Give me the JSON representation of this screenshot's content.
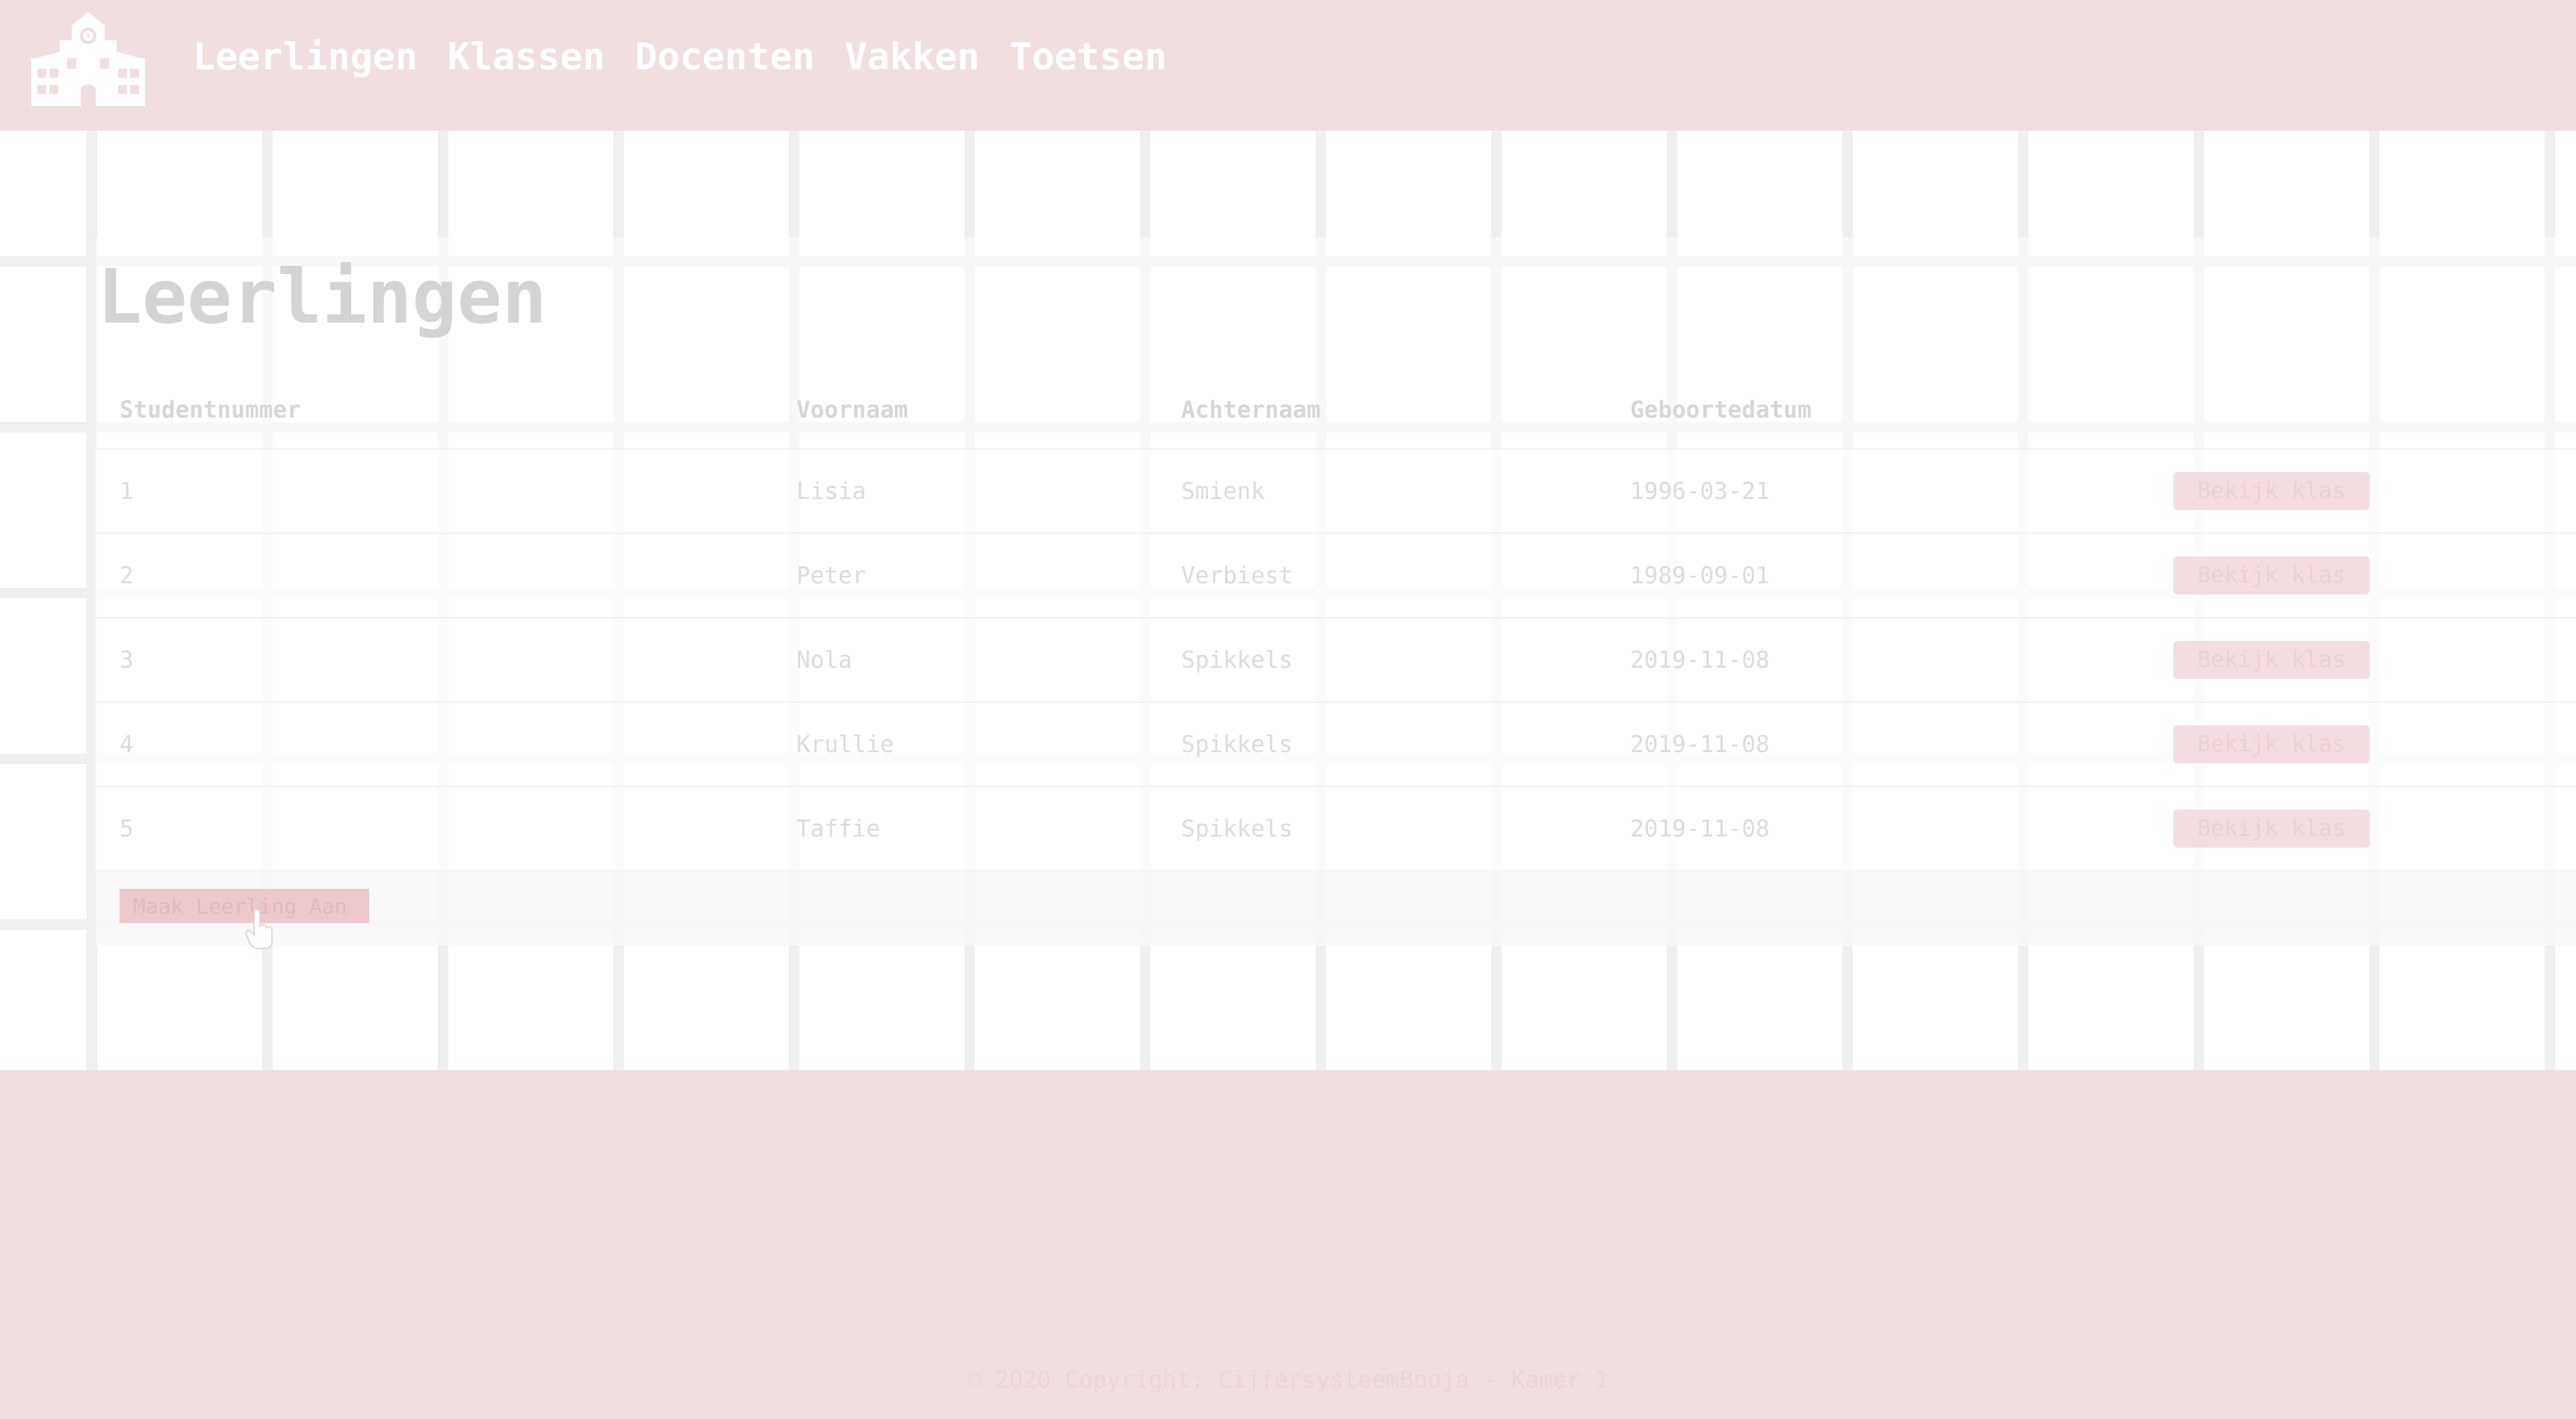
{
  "nav": {
    "logo_icon": "school-building-icon",
    "links": [
      "Leerlingen",
      "Klassen",
      "Docenten",
      "Vakken",
      "Toetsen"
    ]
  },
  "page": {
    "title": "Leerlingen"
  },
  "table": {
    "headers": [
      "Studentnummer",
      "Voornaam",
      "Achternaam",
      "Geboortedatum"
    ],
    "rows": [
      {
        "nr": "1",
        "first": "Lisia",
        "last": "Smienk",
        "dob": "1996-03-21",
        "action": "Bekijk klas"
      },
      {
        "nr": "2",
        "first": "Peter",
        "last": "Verbiest",
        "dob": "1989-09-01",
        "action": "Bekijk klas"
      },
      {
        "nr": "3",
        "first": "Nola",
        "last": "Spikkels",
        "dob": "2019-11-08",
        "action": "Bekijk klas"
      },
      {
        "nr": "4",
        "first": "Krullie",
        "last": "Spikkels",
        "dob": "2019-11-08",
        "action": "Bekijk klas"
      },
      {
        "nr": "5",
        "first": "Taffie",
        "last": "Spikkels",
        "dob": "2019-11-08",
        "action": "Bekijk klas"
      }
    ]
  },
  "actions": {
    "add_student": "Maak Leerling Aan"
  },
  "footer": {
    "copyright": "© 2020 Copyright: CijfersysteemBooja - Kamer 1"
  },
  "colors": {
    "header_bg": "#f1dedf",
    "accent": "#f4dde0"
  }
}
